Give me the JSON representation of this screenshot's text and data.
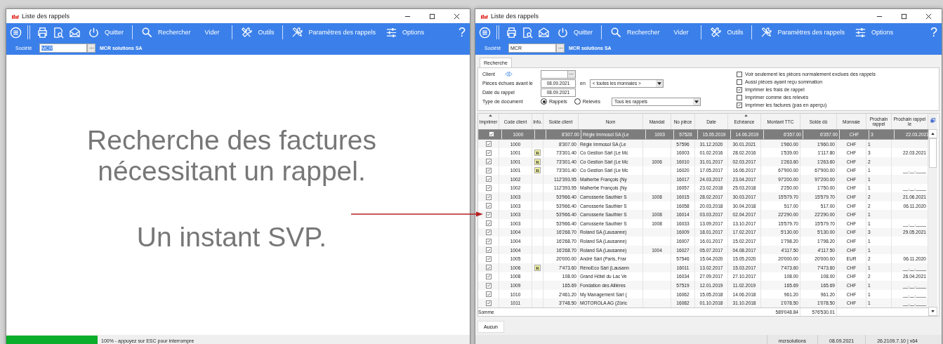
{
  "windows": [
    {
      "kind": "progress",
      "title": "Liste des rappels",
      "toolbar": [
        "Quitter",
        "Rechercher",
        "Vider",
        "Outils",
        "Paramètres des rappels",
        "Options"
      ],
      "help": "?",
      "company": {
        "label": "Société",
        "code": "MCR",
        "code_selected": true,
        "name": "MCR solutions SA"
      },
      "message": "Recherche des factures nécessitant un rappel.",
      "submessage": "Un instant SVP.",
      "progress": {
        "level": 1,
        "text": "100% - appuyez sur ESC pour interrompre"
      }
    },
    {
      "kind": "list",
      "title": "Liste des rappels",
      "toolbar": [
        "Quitter",
        "Rechercher",
        "Vider",
        "Outils",
        "Paramètres des rappels",
        "Options"
      ],
      "help": "?",
      "company": {
        "label": "Société",
        "code": "MCR",
        "code_selected": false,
        "name": "MCR solutions SA"
      },
      "search": {
        "tab": {
          "label": "Recherche",
          "selected": true
        },
        "client_label": "Client",
        "due_label": "Pièces échues avant le",
        "due_date": "08.09.2021",
        "currency_prefix": "en",
        "currency": "< toutes les monnaies >",
        "reminder_label": "Date du rappel",
        "reminder_date": "08.09.2021",
        "doctype_label": "Type de document",
        "doctype_options": [
          {
            "label": "Rappels",
            "selected": true
          },
          {
            "label": "Relevés",
            "selected": false
          }
        ],
        "scope": "Tous les rappels",
        "options": [
          {
            "label": "Voir seulement les pièces normalement exclues des rappels",
            "checked": false
          },
          {
            "label": "Aussi pièces ayant reçu sommation",
            "checked": false
          },
          {
            "label": "Imprimer les frais de rappel",
            "checked": true
          },
          {
            "label": "Imprimer comme des relevés",
            "checked": false
          },
          {
            "label": "Imprimer les factures (pas en aperçu)",
            "checked": true
          }
        ]
      },
      "table": {
        "columns": [
          {
            "label": "Imprimer",
            "sorted": true
          },
          {
            "label": "Code client",
            "sorted": false
          },
          {
            "label": "Info.",
            "sorted": false
          },
          {
            "label": "Solde client",
            "sorted": false
          },
          {
            "label": "Nom",
            "sorted": false
          },
          {
            "label": "Mandat",
            "sorted": false
          },
          {
            "label": "No pièce",
            "sorted": false
          },
          {
            "label": "Date",
            "sorted": false
          },
          {
            "label": "Echéance",
            "sorted": true
          },
          {
            "label": "Montant TTC",
            "sorted": false
          },
          {
            "label": "Solde dû",
            "sorted": false
          },
          {
            "label": "Monnaie",
            "sorted": false
          },
          {
            "label": "Prochain rappel",
            "sorted": false
          },
          {
            "label": "Prochain rappel le",
            "sorted": false
          }
        ],
        "rows": [
          {
            "selected": true,
            "print": true,
            "code": "1000",
            "balance": "8'307.00",
            "name": "Régie Immosol SA (Le",
            "mandate": "1003",
            "number": "57528",
            "date": "15.05.2019",
            "due": "14.06.2019",
            "amount": "6'357.00",
            "due_balance": "6'357.00",
            "currency": "CHF",
            "next_level": "3",
            "next_date": "22.03.2021"
          },
          {
            "selected": false,
            "print": true,
            "code": "1000",
            "balance": "8'307.00",
            "name": "Régie Immosol SA (Le",
            "number": "57596",
            "date": "31.12.2020",
            "due": "30.01.2021",
            "amount": "1'960.00",
            "due_balance": "1'960.00",
            "currency": "CHF",
            "next_level": "1"
          },
          {
            "selected": false,
            "print": true,
            "code": "1001",
            "info": "R",
            "balance": "73'301.40",
            "name": "Co Gestion Sàrl (Le Mc",
            "number": "16003",
            "date": "01.02.2016",
            "due": "28.02.2016",
            "amount": "1'539.00",
            "due_balance": "1'117.80",
            "currency": "CHF",
            "next_level": "3",
            "next_date": "22.03.2021"
          },
          {
            "selected": false,
            "print": true,
            "code": "1001",
            "info": "R",
            "balance": "73'301.40",
            "name": "Co Gestion Sàrl (Le Mc",
            "mandate": "1006",
            "number": "16010",
            "date": "31.01.2017",
            "due": "02.03.2017",
            "amount": "1'263.60",
            "due_balance": "1'263.60",
            "currency": "CHF",
            "next_level": "2"
          },
          {
            "selected": false,
            "print": true,
            "code": "1001",
            "info": "R",
            "balance": "73'301.40",
            "name": "Co Gestion Sàrl (Le Mc",
            "number": "16020",
            "date": "17.05.2017",
            "due": "16.06.2017",
            "amount": "67'900.00",
            "due_balance": "67'900.00",
            "currency": "CHF",
            "next_level": "1",
            "next_date": "__.__.____"
          },
          {
            "selected": false,
            "print": true,
            "code": "1002",
            "balance": "112'393.95",
            "name": "Malherbe François (Ny",
            "number": "16017",
            "date": "24.03.2017",
            "due": "23.04.2017",
            "amount": "97'200.00",
            "due_balance": "97'200.00",
            "currency": "CHF",
            "next_level": "1"
          },
          {
            "selected": false,
            "print": true,
            "code": "1002",
            "balance": "112'393.95",
            "name": "Malherbe François (Ny",
            "number": "16057",
            "date": "23.02.2018",
            "due": "25.03.2018",
            "amount": "2'250.00",
            "due_balance": "1'750.00",
            "currency": "CHF",
            "next_level": "1",
            "next_date": "__.__.____"
          },
          {
            "selected": false,
            "print": true,
            "code": "1003",
            "balance": "53'966.40",
            "name": "Carrosserie Sauthier S",
            "mandate": "1008",
            "number": "16015",
            "date": "28.02.2017",
            "due": "30.03.2017",
            "amount": "15'579.70",
            "due_balance": "15'579.70",
            "currency": "CHF",
            "next_level": "2",
            "next_date": "21.06.2021"
          },
          {
            "selected": false,
            "print": true,
            "code": "1003",
            "balance": "53'966.40",
            "name": "Carrosserie Sauthier S",
            "number": "16058",
            "date": "20.03.2018",
            "due": "30.04.2018",
            "amount": "517.00",
            "due_balance": "517.00",
            "currency": "CHF",
            "next_level": "2",
            "next_date": "06.11.2020"
          },
          {
            "selected": false,
            "print": true,
            "code": "1003",
            "balance": "53'966.40",
            "name": "Carrosserie Sauthier S",
            "mandate": "1008",
            "number": "16014",
            "date": "03.03.2017",
            "due": "02.04.2017",
            "amount": "22'290.00",
            "due_balance": "22'290.00",
            "currency": "CHF",
            "next_level": "1"
          },
          {
            "selected": false,
            "print": true,
            "code": "1003",
            "balance": "53'966.40",
            "name": "Carrosserie Sauthier S",
            "mandate": "1008",
            "number": "16033",
            "date": "13.09.2017",
            "due": "13.10.2017",
            "amount": "15'579.70",
            "due_balance": "15'579.70",
            "currency": "CHF",
            "next_level": "1",
            "next_date": "__.__.____"
          },
          {
            "selected": false,
            "print": true,
            "code": "1004",
            "balance": "16'268.70",
            "name": "Roland SA (Lausanne)",
            "number": "16009",
            "date": "18.01.2017",
            "due": "17.02.2017",
            "amount": "5'130.00",
            "due_balance": "5'130.00",
            "currency": "CHF",
            "next_level": "3",
            "next_date": "29.05.2021"
          },
          {
            "selected": false,
            "print": true,
            "code": "1004",
            "balance": "16'268.70",
            "name": "Roland SA (Lausanne)",
            "number": "16007",
            "date": "16.01.2017",
            "due": "15.02.2017",
            "amount": "1'798.20",
            "due_balance": "1'798.20",
            "currency": "CHF",
            "next_level": "1"
          },
          {
            "selected": false,
            "print": true,
            "code": "1004",
            "balance": "16'268.70",
            "name": "Roland SA (Lausanne)",
            "mandate": "1004",
            "number": "16027",
            "date": "05.07.2017",
            "due": "04.08.2017",
            "amount": "4'117.50",
            "due_balance": "4'117.50",
            "currency": "CHF",
            "next_level": "1"
          },
          {
            "selected": false,
            "print": true,
            "code": "1005",
            "balance": "20'000.00",
            "name": "André Sàrl (Paris, Frar",
            "number": "57546",
            "date": "15.04.2020",
            "due": "15.05.2020",
            "amount": "20'000.00",
            "due_balance": "20'000.00",
            "currency": "EUR",
            "next_level": "2",
            "next_date": "06.11.2020"
          },
          {
            "selected": false,
            "print": true,
            "code": "1006",
            "info": "R",
            "balance": "7'473.60",
            "name": "RénoEco Sàrl (Lausann",
            "number": "16011",
            "date": "13.02.2017",
            "due": "15.03.2017",
            "amount": "7'473.60",
            "due_balance": "7'473.60",
            "currency": "CHF",
            "next_level": "1",
            "next_date": "__.__.____"
          },
          {
            "selected": false,
            "print": true,
            "code": "1008",
            "balance": "108.00",
            "name": "Grand Hôtel du Lac Ve",
            "number": "16034",
            "date": "27.09.2017",
            "due": "27.10.2017",
            "amount": "108.00",
            "due_balance": "108.00",
            "currency": "CHF",
            "next_level": "2",
            "next_date": "26.04.2021"
          },
          {
            "selected": false,
            "print": true,
            "code": "1009",
            "balance": "165.69",
            "name": "Fondation des Allières",
            "number": "57519",
            "date": "12.01.2019",
            "due": "11.02.2019",
            "amount": "165.69",
            "due_balance": "165.69",
            "currency": "CHF",
            "next_level": "1",
            "next_date": "__.__.____"
          },
          {
            "selected": false,
            "print": true,
            "code": "1010",
            "balance": "2'461.20",
            "name": "My Management Sàrl (",
            "number": "16062",
            "date": "15.05.2018",
            "due": "14.06.2018",
            "amount": "961.20",
            "due_balance": "961.20",
            "currency": "CHF",
            "next_level": "1",
            "next_date": "__.__.____"
          },
          {
            "selected": false,
            "print": true,
            "code": "1011",
            "balance": "3'748.50",
            "name": "MOTOROLA AG  (Züric",
            "number": "16082",
            "date": "01.10.2018",
            "due": "31.10.2018",
            "amount": "1'078.50",
            "due_balance": "1'078.50",
            "currency": "CHF",
            "next_level": "1",
            "next_date": "__.__.____"
          }
        ],
        "total_label": "Somme",
        "total_amount": "589'048.84",
        "total_due": "576'530.01"
      },
      "button": "Aucun",
      "status": [
        "mcrsolutions",
        "08.09.2021",
        "26.2109.7.10 | x64"
      ]
    }
  ]
}
